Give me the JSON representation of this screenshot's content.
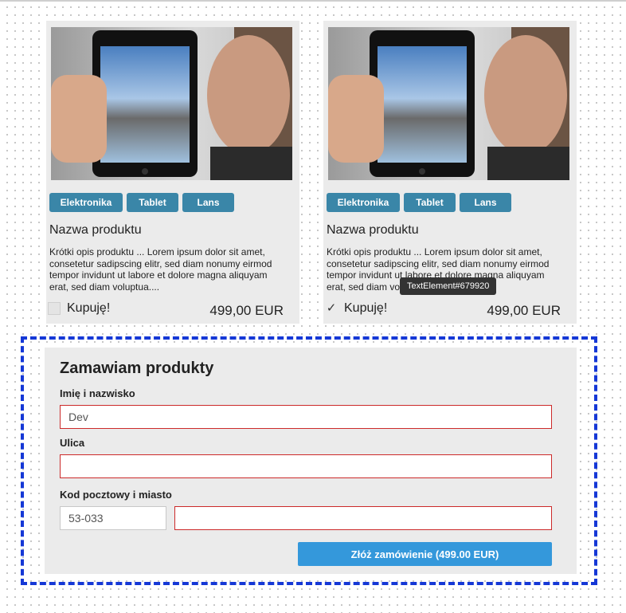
{
  "products": [
    {
      "tags": [
        "Elektronika",
        "Tablet",
        "Lans"
      ],
      "name": "Nazwa produktu",
      "description": "Krótki opis produktu ... Lorem ipsum dolor sit amet, consetetur sadipscing elitr, sed diam nonumy eirmod tempor invidunt ut labore et dolore magna aliquyam erat, sed diam voluptua....",
      "buy_label": "Kupuję!",
      "checked": false,
      "price": "499,00 EUR"
    },
    {
      "tags": [
        "Elektronika",
        "Tablet",
        "Lans"
      ],
      "name": "Nazwa produktu",
      "description": "Krótki opis produktu ... Lorem ipsum dolor sit amet, consetetur sadipscing elitr, sed diam nonumy eirmod tempor invidunt ut labore et dolore magna aliquyam erat, sed diam voluptua....",
      "buy_label": "Kupuję!",
      "checked": true,
      "check_glyph": "✓",
      "price": "499,00 EUR"
    }
  ],
  "tooltip": "TextElement#679920",
  "order_form": {
    "title": "Zamawiam produkty",
    "name_label": "Imię i nazwisko",
    "name_value": "Dev",
    "street_label": "Ulica",
    "street_value": "",
    "city_label": "Kod pocztowy i miasto",
    "postal_value": "53-033",
    "city_value": "",
    "submit_label": "Złóż zamówienie (499.00 EUR)"
  },
  "colors": {
    "tag_bg": "#3a86a8",
    "submit_bg": "#3498db",
    "invalid_border": "#cc2a2a",
    "selection_dash": "#1538d6"
  }
}
